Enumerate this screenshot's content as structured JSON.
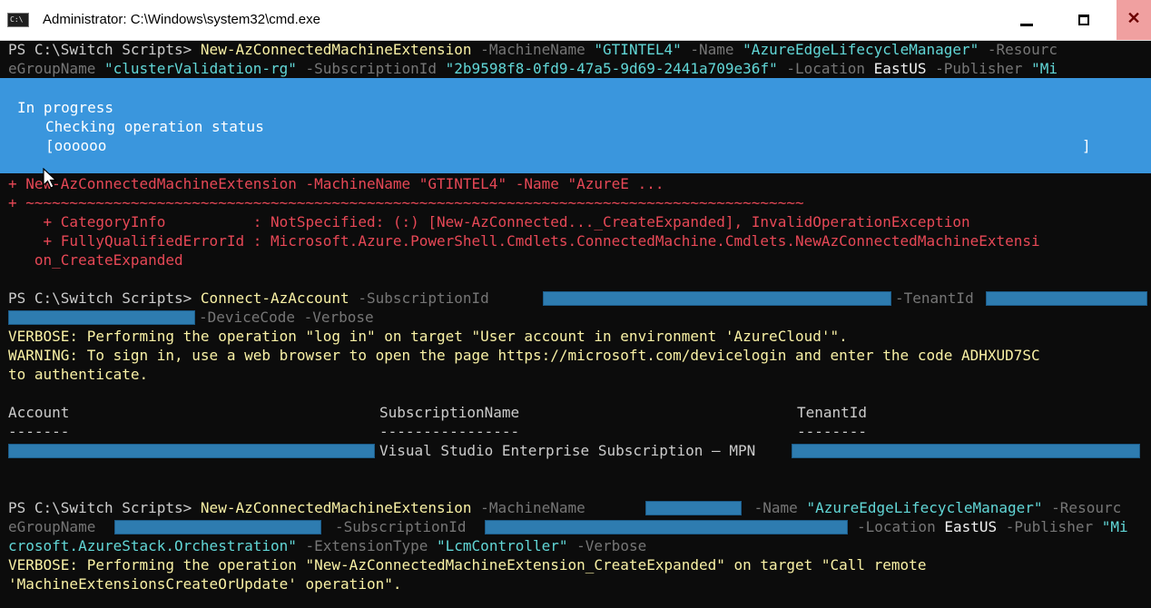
{
  "window": {
    "title": "Administrator: C:\\Windows\\system32\\cmd.exe",
    "icon_label": "C:\\",
    "buttons": [
      "minimize",
      "maximize",
      "close"
    ]
  },
  "console": {
    "cmd1": {
      "prompt": "PS C:\\Switch Scripts> ",
      "command": "New-AzConnectedMachineExtension",
      "p_machine": " -MachineName ",
      "v_machine": "\"GTINTEL4\"",
      "p_name": " -Name ",
      "v_name": "\"AzureEdgeLifecycleManager\"",
      "p_res_a": " -Resourc",
      "p_res_b": "eGroupName ",
      "v_res": "\"clusterValidation-rg\"",
      "p_sub": " -SubscriptionId ",
      "v_sub": "\"2b9598f8-0fd9-47a5-9d69-2441a709e36f\"",
      "p_loc": " -Location ",
      "v_loc": "EastUS",
      "p_pub": " -Publisher ",
      "v_pub": "\"Mi"
    },
    "progress": {
      "status": "In progress",
      "activity": "Checking operation status",
      "bar_start": "[oooooo",
      "bar_end": "]"
    },
    "error": {
      "line1": "+ New-AzConnectedMachineExtension -MachineName \"GTINTEL4\" -Name \"AzureE ...",
      "line2": "+ ~~~~~~~~~~~~~~~~~~~~~~~~~~~~~~~~~~~~~~~~~~~~~~~~~~~~~~~~~~~~~~~~~~~~~~~~~~~~~~~~~~~~~~~~~",
      "line3": "    + CategoryInfo          : NotSpecified: (:) [New-AzConnected..._CreateExpanded], InvalidOperationException",
      "line4": "    + FullyQualifiedErrorId : Microsoft.Azure.PowerShell.Cmdlets.ConnectedMachine.Cmdlets.NewAzConnectedMachineExtensi",
      "line5": "   on_CreateExpanded"
    },
    "cmd2": {
      "prompt": "PS C:\\Switch Scripts> ",
      "command": "Connect-AzAccount",
      "p_sub": " -SubscriptionId ",
      "p_tenant": "-TenantId",
      "p_rest": "-DeviceCode -Verbose"
    },
    "verbose1": "VERBOSE: Performing the operation \"log in\" on target \"User account in environment 'AzureCloud'\".",
    "warning1": "WARNING: To sign in, use a web browser to open the page https://microsoft.com/devicelogin and enter the code ADHXUD7SC",
    "warning2": "to authenticate.",
    "table": {
      "col_account": "Account",
      "col_subscription": "SubscriptionName",
      "col_tenant": "TenantId",
      "dash_account": "-------",
      "dash_subscription": "----------------",
      "dash_tenant": "--------",
      "row_subscription": "Visual Studio Enterprise Subscription – MPN"
    },
    "cmd3": {
      "prompt": "PS C:\\Switch Scripts> ",
      "command": "New-AzConnectedMachineExtension",
      "p_machine": " -MachineName ",
      "p_name": " -Name ",
      "v_name": "\"AzureEdgeLifecycleManager\"",
      "p_res_a": " -Resourc",
      "p_res_b": "eGroupName ",
      "p_sub": "-SubscriptionId ",
      "p_loc": "-Location ",
      "v_loc": "EastUS",
      "p_pub": " -Publisher ",
      "v_pub_a": "\"Mi",
      "v_pub_b": "crosoft.AzureStack.Orchestration\"",
      "p_ext": " -ExtensionType ",
      "v_ext": "\"LcmController\"",
      "p_verbose": " -Verbose"
    },
    "verbose2a": "VERBOSE: Performing the operation \"New-AzConnectedMachineExtension_CreateExpanded\" on target \"Call remote",
    "verbose2b": "'MachineExtensionsCreateOrUpdate' operation\"."
  }
}
